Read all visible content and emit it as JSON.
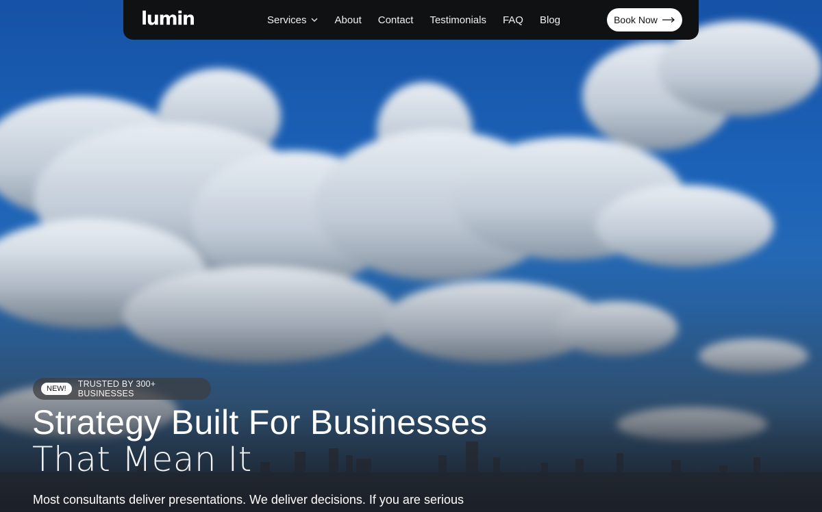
{
  "brand": {
    "logo": "lumin"
  },
  "nav": {
    "items": [
      {
        "label": "Services",
        "has_dropdown": true
      },
      {
        "label": "About"
      },
      {
        "label": "Contact"
      },
      {
        "label": "Testimonials"
      },
      {
        "label": "FAQ"
      },
      {
        "label": "Blog"
      }
    ],
    "cta_label": "Book Now"
  },
  "hero": {
    "badge_pill": "NEW!",
    "badge_text": "TRUSTED BY 300+ BUSINESSES",
    "headline_line1": "Strategy Built For Businesses",
    "headline_line2": "That Mean It",
    "subtext": "Most consultants deliver presentations. We deliver decisions. If you are serious"
  },
  "colors": {
    "navbar_bg": "#0f1112",
    "sky": "#1c63b8",
    "button_bg": "#ffffff",
    "text": "#ffffff"
  },
  "icons": {
    "dropdown": "chevron-down-icon",
    "cta": "arrow-right-icon"
  }
}
